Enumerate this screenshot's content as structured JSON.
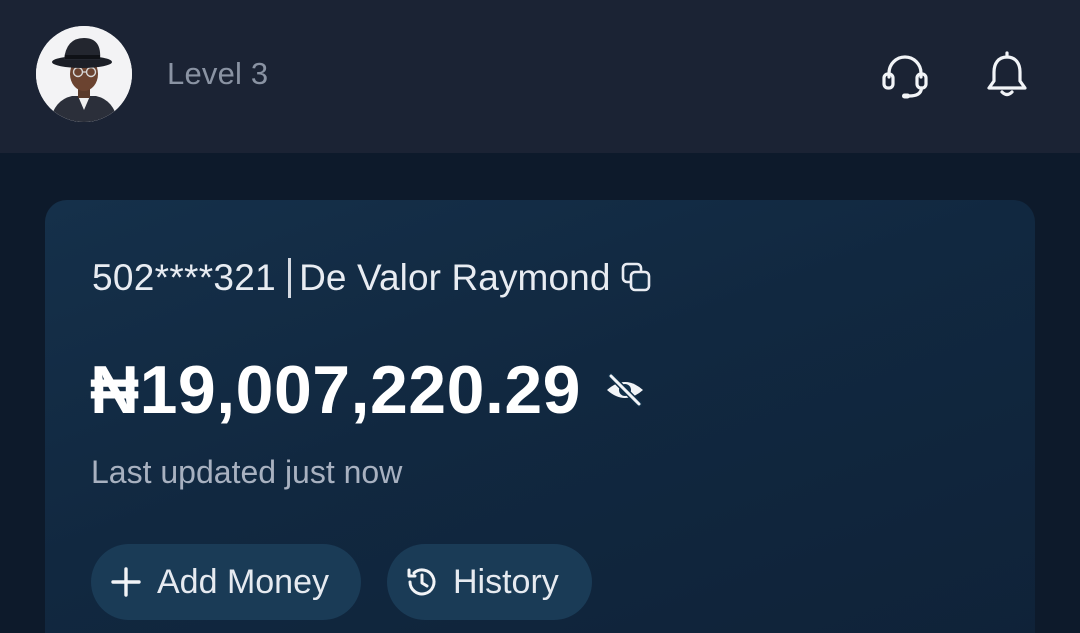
{
  "header": {
    "level_label": "Level 3",
    "icons": [
      "support-headset-icon",
      "notification-bell-icon"
    ]
  },
  "account": {
    "number_masked": "502****321",
    "name": "De Valor Raymond"
  },
  "balance": {
    "amount": "₦19,007,220.29",
    "last_updated": "Last updated just now"
  },
  "actions": {
    "add_money_label": "Add Money",
    "history_label": "History"
  },
  "colors": {
    "header_bg": "#1b2334",
    "screen_bg": "#0d1a2b",
    "card_bg": "#15304a",
    "button_bg": "#1a3b56",
    "text_primary": "#ffffff",
    "text_muted": "#8a93a3"
  }
}
